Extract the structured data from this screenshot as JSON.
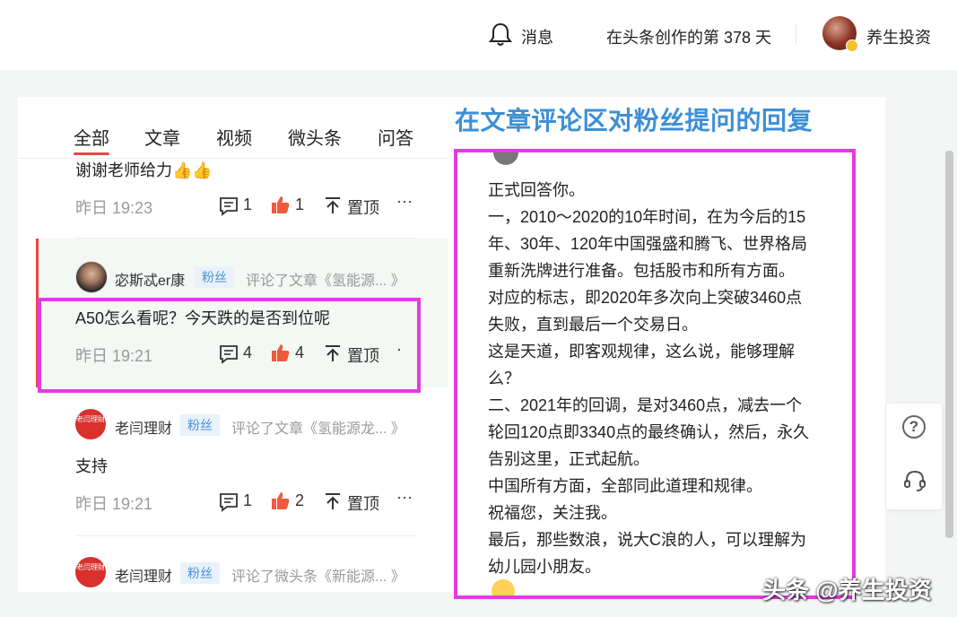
{
  "topbar": {
    "messages_label": "消息",
    "creation_days": "在头条创作的第 378 天",
    "username": "养生投资"
  },
  "tabs": [
    "全部",
    "文章",
    "视频",
    "微头条",
    "问答"
  ],
  "items": [
    {
      "text": "谢谢老师给力👍👍",
      "time": "昨日 19:23",
      "comments": "1",
      "likes": "1",
      "pin_label": "置顶",
      "more": "···"
    },
    {
      "user": "宓斯忒er康",
      "badge": "粉丝",
      "commented_on": "评论了文章《氢能源... 》",
      "text": "A50怎么看呢？今天跌的是否到位呢",
      "time": "昨日 19:21",
      "comments": "4",
      "likes": "4",
      "pin_label": "置顶",
      "more": "·"
    },
    {
      "user": "老闫理财",
      "avatar_text": "老闫理财",
      "badge": "粉丝",
      "commented_on": "评论了文章《氢能源龙... 》",
      "text": "支持",
      "time": "昨日 19:21",
      "comments": "1",
      "likes": "2",
      "pin_label": "置顶",
      "more": "···"
    },
    {
      "user": "老闫理财",
      "avatar_text": "老闫理财",
      "badge": "粉丝",
      "commented_on": "评论了微头条《新能源... 》"
    }
  ],
  "annotation_title": "在文章评论区对粉丝提问的回复",
  "reply_lines": [
    "正式回答你。",
    "一，2010～2020的10年时间，在为今后的15",
    "年、30年、120年中国强盛和腾飞、世界格局",
    "重新洗牌进行准备。包括股市和所有方面。",
    "对应的标志，即2020年多次向上突破3460点",
    "失败，直到最后一个交易日。",
    "这是天道，即客观规律，这么说，能够理解",
    "么？",
    "二、2021年的回调，是对3460点，减去一个",
    "轮回120点即3340点的最终确认，然后，永久",
    "告别这里，正式起航。",
    "中国所有方面，全部同此道理和规律。",
    "祝福您，关注我。",
    "最后，那些数浪，说大C浪的人，可以理解为",
    "幼儿园小朋友。"
  ],
  "help_icon_text": "?",
  "watermark": "头条 @养生投资",
  "colors": {
    "accent": "#e8483f",
    "highlight": "#e33be0",
    "annotation": "#3d8fd6",
    "fan_badge": "#4a90d9"
  }
}
